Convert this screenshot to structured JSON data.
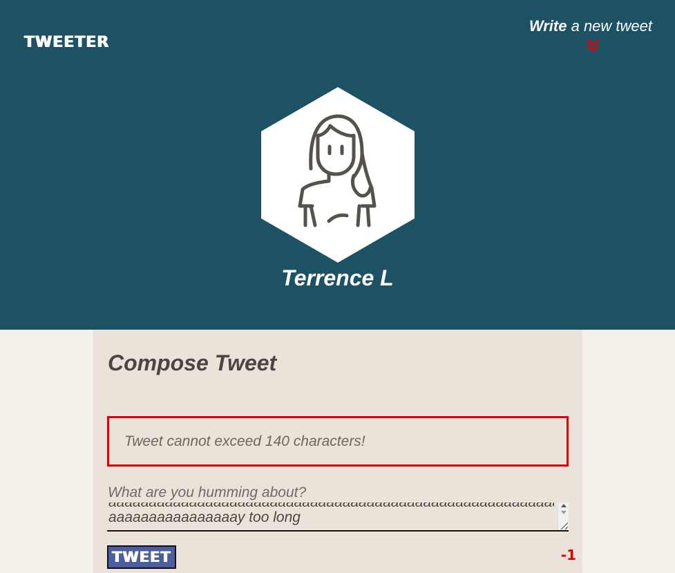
{
  "header": {
    "brand": "TWEETER",
    "write_bold": "Write",
    "write_rest": " a new tweet",
    "username": "Terrence L"
  },
  "compose": {
    "title": "Compose Tweet",
    "error": "Tweet cannot exceed 140 characters!",
    "placeholder": "What are you humming about?",
    "textarea_prev_line": "aaaaaaaaaaaaaaaaaaaaaaaaaaaaaaaaaaaaaaaaaaaaaaaaaaaaaaaaaaaaaaa",
    "textarea_current_line": "aaaaaaaaaaaaaaaay too long",
    "button_label": "TWEET",
    "counter": "-1"
  },
  "colors": {
    "header_bg": "#1c5264",
    "page_bg": "#f3efe9",
    "panel_bg": "#ebe3d9",
    "error": "#e30000",
    "button_bg": "#4b5ea0"
  },
  "icons": {
    "chevron": "double-chevron-down-icon",
    "avatar": "user-avatar-icon"
  }
}
